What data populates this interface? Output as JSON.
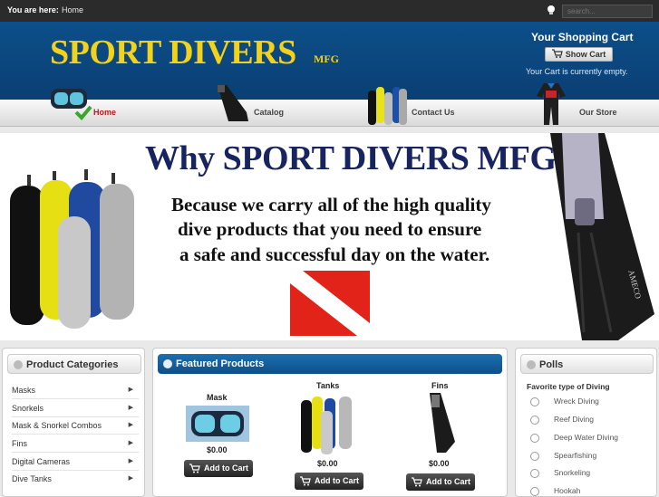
{
  "topbar": {
    "breadcrumb_label": "You are here:",
    "breadcrumb_home": "Home",
    "search_placeholder": "search..."
  },
  "header": {
    "logo": "SPORT DIVERS",
    "logo_suffix": "MFG",
    "cart_title": "Your Shopping Cart",
    "show_cart": "Show Cart",
    "cart_status": "Your Cart is currently empty."
  },
  "nav": {
    "home": "Home",
    "catalog": "Catalog",
    "contact": "Contact Us",
    "store": "Our Store"
  },
  "banner": {
    "title": "Why SPORT DIVERS MFG?",
    "line1": "Because we carry all of the high quality",
    "line2": "dive products that you need to ensure",
    "line3": "a safe and successful day on the water.",
    "fin_brand": "AMECO"
  },
  "categories": {
    "title": "Product Categories",
    "items": [
      "Masks",
      "Snorkels",
      "Mask & Snorkel Combos",
      "Fins",
      "Digital Cameras",
      "Dive Tanks"
    ]
  },
  "featured": {
    "title": "Featured Products",
    "products": [
      {
        "name": "Mask",
        "price": "$0.00",
        "button": "Add to Cart"
      },
      {
        "name": "Tanks",
        "price": "$0.00",
        "button": "Add to Cart"
      },
      {
        "name": "Fins",
        "price": "$0.00",
        "button": "Add to Cart"
      }
    ]
  },
  "polls": {
    "title": "Polls",
    "question": "Favorite type of Diving",
    "options": [
      "Wreck Diving",
      "Reef Diving",
      "Deep Water Diving",
      "Spearfishing",
      "Snorkeling",
      "Hookah"
    ]
  },
  "colors": {
    "header_blue": "#0d4f8a",
    "logo_gold": "#f2d21a",
    "active_nav": "#c0161b",
    "banner_title": "#17245f",
    "dive_flag_red": "#e2231a"
  }
}
